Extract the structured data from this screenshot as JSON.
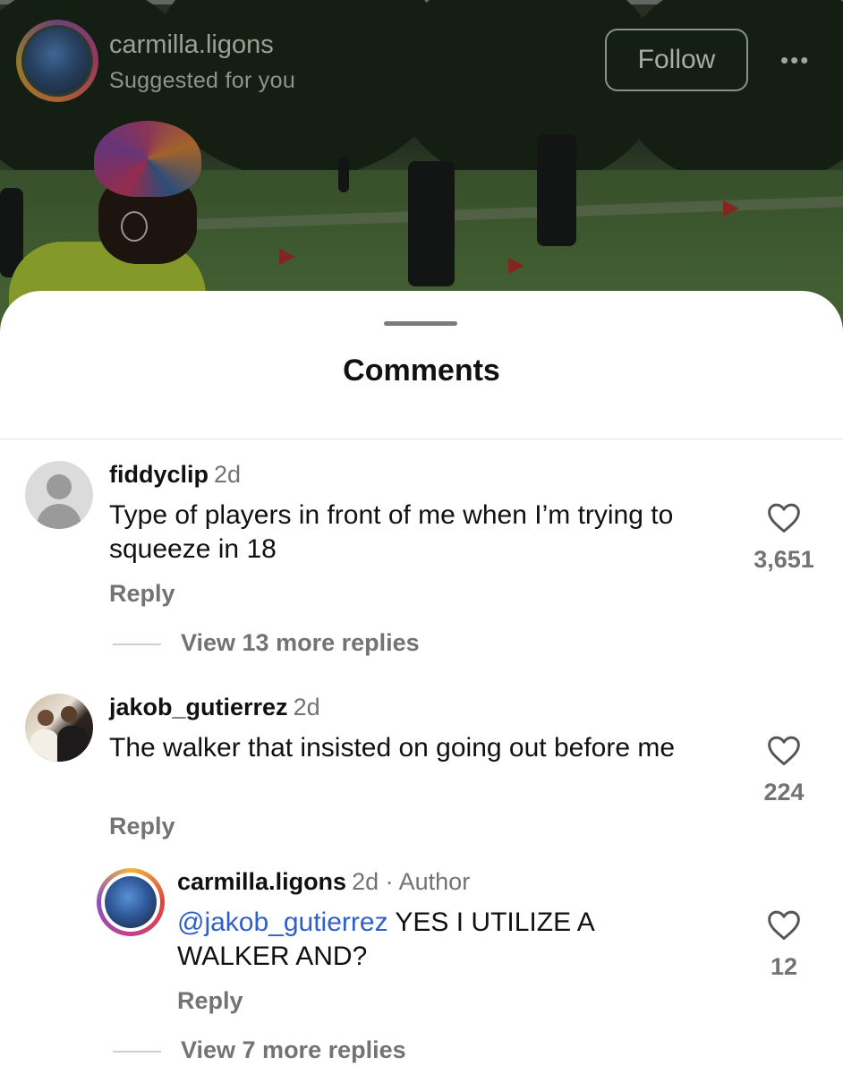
{
  "post": {
    "username": "carmilla.ligons",
    "subtitle": "Suggested for you",
    "follow_label": "Follow",
    "more_icon": "•••"
  },
  "sheet": {
    "title": "Comments"
  },
  "comments": [
    {
      "username": "fiddyclip",
      "time": "2d",
      "text": "Type of players in front of me when I’m trying to squeeze in 18",
      "likes": "3,651",
      "reply_label": "Reply",
      "view_replies": "View 13 more replies",
      "avatar_icon": "default-profile-icon"
    },
    {
      "username": "jakob_gutierrez",
      "time": "2d",
      "text": "The walker that insisted on going out before me",
      "likes": "224",
      "reply_label": "Reply",
      "avatar_icon": "profile-photo"
    }
  ],
  "reply": {
    "username": "carmilla.ligons",
    "time": "2d",
    "separator": " · ",
    "author_badge": "Author",
    "mention": "@jakob_gutierrez",
    "text": " YES I UTILIZE A WALKER AND?",
    "likes": "12",
    "reply_label": "Reply",
    "view_replies": "View 7 more replies"
  },
  "colors": {
    "mention": "#2f5fc8",
    "secondary_text": "#737373",
    "sheet_bg": "#ffffff"
  }
}
